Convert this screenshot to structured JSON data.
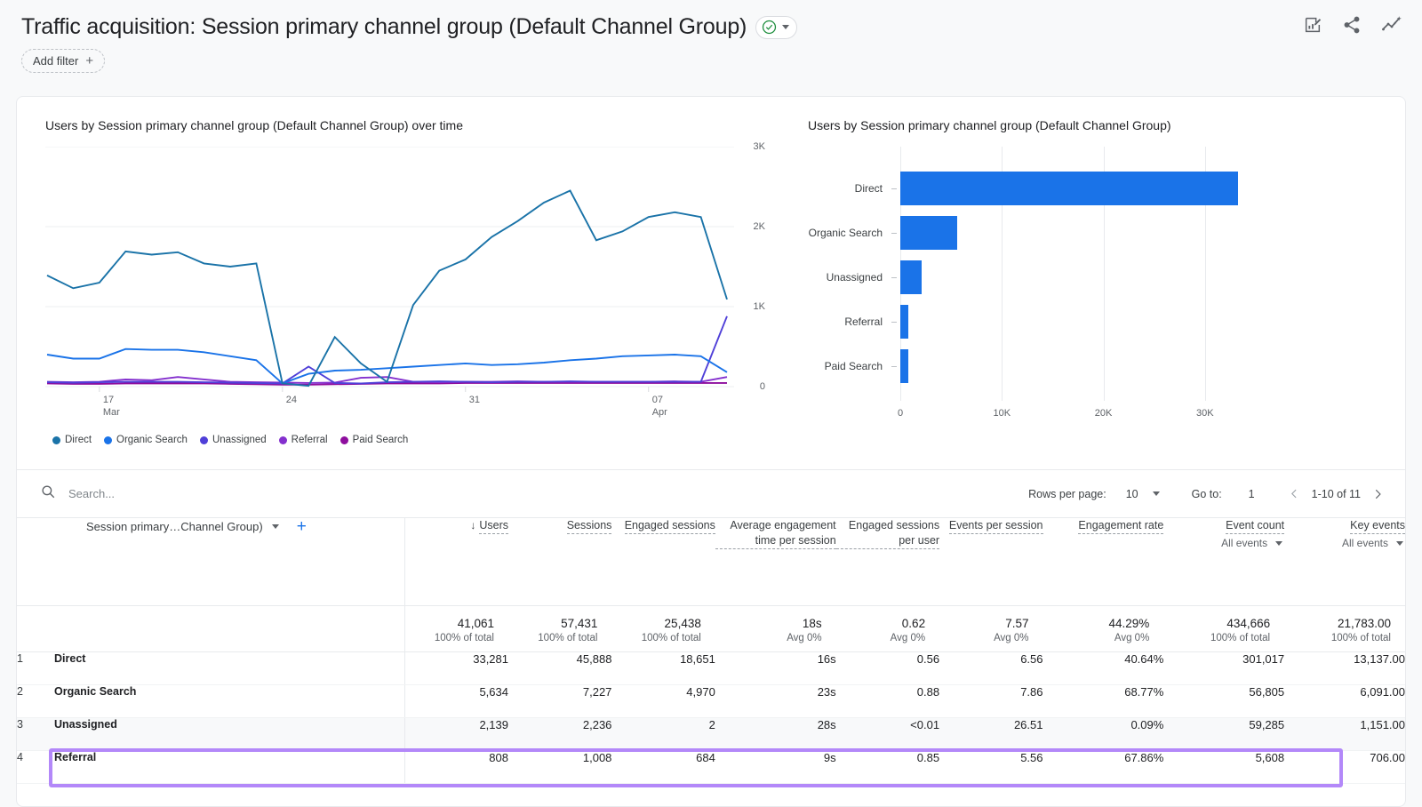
{
  "header": {
    "title": "Traffic acquisition: Session primary channel group (Default Channel Group)",
    "verified_icon": "check-circle-icon",
    "dropdown_icon": "chevron-down-icon",
    "add_filter_label": "Add filter",
    "add_filter_icon": "plus-icon",
    "icons": [
      "edit-chart-icon",
      "share-icon",
      "insights-icon"
    ]
  },
  "line_chart_title": "Users by Session primary channel group (Default Channel Group) over time",
  "bar_chart_title": "Users by Session primary channel group (Default Channel Group)",
  "colors": {
    "direct": "#1a73a8",
    "organic_search": "#1a73e8",
    "unassigned": "#4f3fd8",
    "referral": "#8430ce",
    "paid_search": "#8e0e9e",
    "bar": "#1a73e8",
    "accent": "#1a73e8",
    "highlight": "#b388f9"
  },
  "chart_data": [
    {
      "type": "line",
      "title": "Users by Session primary channel group (Default Channel Group) over time",
      "xlabel": "",
      "ylabel": "Users",
      "ylim": [
        0,
        3000
      ],
      "yticks": [
        "0",
        "1K",
        "2K",
        "3K"
      ],
      "xticks": [
        {
          "label": "17",
          "sublabel": "Mar"
        },
        {
          "label": "24",
          "sublabel": ""
        },
        {
          "label": "31",
          "sublabel": ""
        },
        {
          "label": "07",
          "sublabel": "Apr"
        }
      ],
      "grid": true,
      "legend_position": "bottom",
      "series": [
        {
          "name": "Direct",
          "color": "#1a73a8",
          "values": [
            1390,
            1230,
            1300,
            1690,
            1650,
            1680,
            1540,
            1500,
            1540,
            40,
            10,
            620,
            290,
            60,
            1020,
            1450,
            1590,
            1870,
            2070,
            2300,
            2450,
            1830,
            1940,
            2120,
            2180,
            2120,
            1090
          ]
        },
        {
          "name": "Organic Search",
          "color": "#1a73e8",
          "values": [
            400,
            350,
            350,
            470,
            460,
            460,
            430,
            380,
            330,
            40,
            160,
            200,
            210,
            230,
            250,
            270,
            290,
            270,
            280,
            300,
            330,
            350,
            380,
            390,
            400,
            380,
            180
          ]
        },
        {
          "name": "Unassigned",
          "color": "#4f3fd8",
          "values": [
            55,
            50,
            55,
            60,
            60,
            60,
            55,
            50,
            45,
            40,
            250,
            45,
            40,
            55,
            60,
            65,
            60,
            55,
            60,
            60,
            65,
            60,
            60,
            60,
            60,
            60,
            880
          ]
        },
        {
          "name": "Referral",
          "color": "#8430ce",
          "values": [
            60,
            55,
            60,
            90,
            80,
            120,
            90,
            60,
            55,
            50,
            45,
            50,
            110,
            120,
            60,
            55,
            60,
            60,
            65,
            60,
            60,
            60,
            60,
            60,
            65,
            60,
            120
          ]
        },
        {
          "name": "Paid Search",
          "color": "#8e0e9e",
          "values": [
            40,
            35,
            35,
            40,
            40,
            40,
            40,
            35,
            30,
            25,
            25,
            30,
            35,
            40,
            40,
            40,
            45,
            45,
            45,
            45,
            45,
            45,
            45,
            45,
            45,
            45,
            45
          ]
        }
      ]
    },
    {
      "type": "bar",
      "orientation": "horizontal",
      "title": "Users by Session primary channel group (Default Channel Group)",
      "categories": [
        "Direct",
        "Organic Search",
        "Unassigned",
        "Referral",
        "Paid Search"
      ],
      "values": [
        33281,
        5634,
        2139,
        808,
        786
      ],
      "xticks": [
        "0",
        "10K",
        "20K",
        "30K"
      ],
      "xlim": [
        0,
        35000
      ],
      "ylabel": "",
      "xlabel": "",
      "grid": true
    }
  ],
  "legend": [
    {
      "label": "Direct",
      "color": "#1a73a8"
    },
    {
      "label": "Organic Search",
      "color": "#1a73e8"
    },
    {
      "label": "Unassigned",
      "color": "#4f3fd8"
    },
    {
      "label": "Referral",
      "color": "#8430ce"
    },
    {
      "label": "Paid Search",
      "color": "#8e0e9e"
    }
  ],
  "toolbar": {
    "search_placeholder": "Search...",
    "search_value": "",
    "search_icon": "search-icon",
    "rows_per_page_label": "Rows per page:",
    "rows_per_page_value": "10",
    "goto_label": "Go to:",
    "goto_value": "1",
    "page_range": "1-10 of 11",
    "prev_icon": "chevron-left-icon",
    "next_icon": "chevron-right-icon"
  },
  "table": {
    "dimension_header": "Session primary…Channel Group)",
    "dimension_caret_icon": "chevron-down-icon",
    "add_dimension_icon": "plus-icon",
    "sort_icon": "arrow-down-icon",
    "metric_headers": [
      {
        "label": "Users",
        "sorted": true,
        "sub": ""
      },
      {
        "label": "Sessions",
        "sorted": false,
        "sub": ""
      },
      {
        "label": "Engaged sessions",
        "sorted": false,
        "sub": ""
      },
      {
        "label": "Average engagement time per session",
        "sorted": false,
        "sub": ""
      },
      {
        "label": "Engaged sessions per user",
        "sorted": false,
        "sub": ""
      },
      {
        "label": "Events per session",
        "sorted": false,
        "sub": ""
      },
      {
        "label": "Engagement rate",
        "sorted": false,
        "sub": ""
      },
      {
        "label": "Event count",
        "sorted": false,
        "sub": "All events"
      },
      {
        "label": "Key events",
        "sorted": false,
        "sub": "All events"
      }
    ],
    "totals": {
      "values": [
        "41,061",
        "57,431",
        "25,438",
        "18s",
        "0.62",
        "7.57",
        "44.29%",
        "434,666",
        "21,783.00"
      ],
      "subs": [
        "100% of total",
        "100% of total",
        "100% of total",
        "Avg 0%",
        "Avg 0%",
        "Avg 0%",
        "Avg 0%",
        "100% of total",
        "100% of total"
      ]
    },
    "rows": [
      {
        "rank": "1",
        "dimension": "Direct",
        "values": [
          "33,281",
          "45,888",
          "18,651",
          "16s",
          "0.56",
          "6.56",
          "40.64%",
          "301,017",
          "13,137.00"
        ],
        "highlighted": true
      },
      {
        "rank": "2",
        "dimension": "Organic Search",
        "values": [
          "5,634",
          "7,227",
          "4,970",
          "23s",
          "0.88",
          "7.86",
          "68.77%",
          "56,805",
          "6,091.00"
        ],
        "highlighted": false
      },
      {
        "rank": "3",
        "dimension": "Unassigned",
        "values": [
          "2,139",
          "2,236",
          "2",
          "28s",
          "<0.01",
          "26.51",
          "0.09%",
          "59,285",
          "1,151.00"
        ],
        "highlighted": false
      },
      {
        "rank": "4",
        "dimension": "Referral",
        "values": [
          "808",
          "1,008",
          "684",
          "9s",
          "0.85",
          "5.56",
          "67.86%",
          "5,608",
          "706.00"
        ],
        "highlighted": false
      }
    ]
  }
}
